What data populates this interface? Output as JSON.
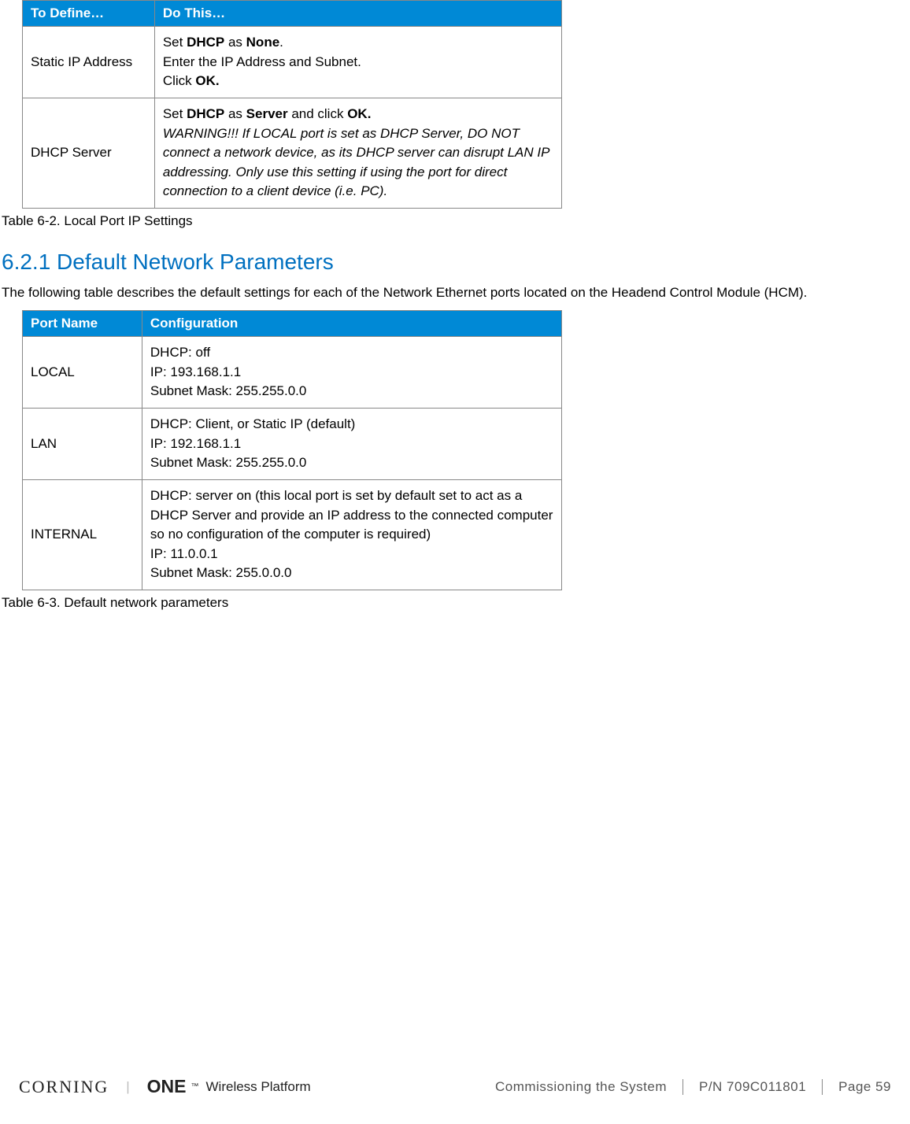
{
  "table1": {
    "headers": [
      "To Define…",
      "Do This…"
    ],
    "rows": [
      {
        "c1": "Static IP Address",
        "c2_pre1": "Set ",
        "c2_b1": "DHCP",
        "c2_mid1": " as ",
        "c2_b2": "None",
        "c2_post1": ".",
        "c2_line2": "Enter the IP Address and Subnet.",
        "c2_line3_pre": "Click ",
        "c2_line3_b": "OK."
      },
      {
        "c1": "DHCP Server",
        "c2_pre1": "Set ",
        "c2_b1": "DHCP",
        "c2_mid1": " as ",
        "c2_b2": "Server",
        "c2_mid2": " and click ",
        "c2_b3": "OK.",
        "c2_warn": "WARNING!!! If LOCAL port is set as DHCP Server, DO NOT connect a network device, as its DHCP server can disrupt LAN IP addressing. Only use this setting if using the port for direct connection to a client device (i.e. PC)."
      }
    ],
    "caption": "Table 6-2. Local Port IP Settings"
  },
  "section": {
    "heading": "6.2.1 Default Network Parameters",
    "intro": "The following table describes the default settings for each of the Network Ethernet ports located on the Headend Control Module (HCM)."
  },
  "table2": {
    "headers": [
      "Port Name",
      "Configuration"
    ],
    "rows": [
      {
        "name": "LOCAL",
        "l1": "DHCP: off",
        "l2": "IP: 193.168.1.1",
        "l3": "Subnet Mask: 255.255.0.0"
      },
      {
        "name": "LAN",
        "l1": "DHCP: Client, or Static IP (default)",
        "l2": "IP: 192.168.1.1",
        "l3": "Subnet Mask: 255.255.0.0"
      },
      {
        "name": "INTERNAL",
        "l1": "DHCP: server on (this local port is set by default set to act as a DHCP Server and provide an IP address to the connected computer so no configuration of the computer is required)",
        "l2": "IP: 11.0.0.1",
        "l3": "Subnet Mask: 255.0.0.0"
      }
    ],
    "caption": "Table 6-3. Default network parameters"
  },
  "footer": {
    "brand1": "CORNING",
    "brand2_bold": "ONE",
    "brand2_tm": "™",
    "brand2_rest": "Wireless Platform",
    "section": "Commissioning the System",
    "pn": "P/N 709C011801",
    "page": "Page 59"
  }
}
